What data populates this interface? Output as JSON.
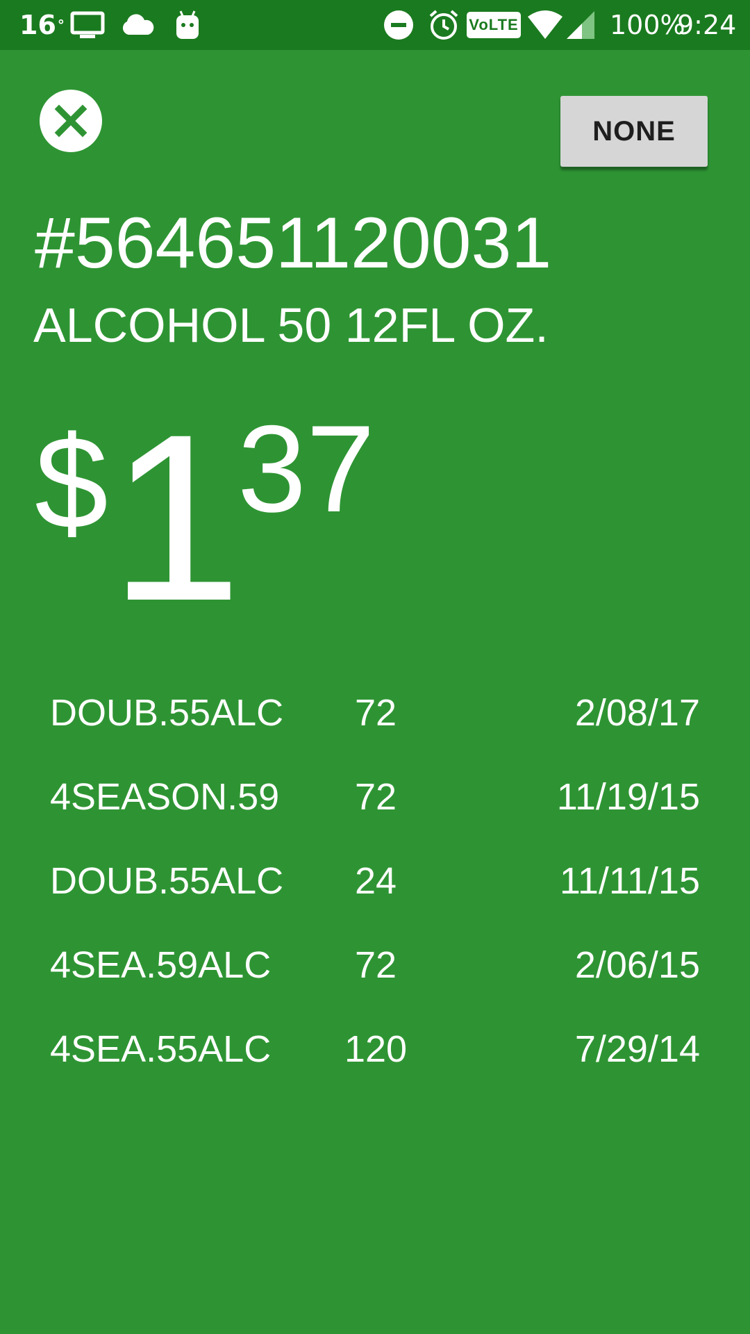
{
  "status_bar": {
    "temperature": "16",
    "temperature_unit": "°",
    "volte_label": "VoLTE",
    "battery": "100%",
    "time": "9:24",
    "icons": [
      "monitor-icon",
      "cloud-icon",
      "android-icon",
      "do-not-disturb-icon",
      "alarm-icon",
      "volte-icon",
      "wifi-icon",
      "cell-signal-icon"
    ]
  },
  "header": {
    "close_icon": "close-icon",
    "none_label": "NONE"
  },
  "product": {
    "number": "#564651120031",
    "description": "ALCOHOL 50 12FL OZ."
  },
  "price": {
    "currency": "$",
    "dollars": "1",
    "cents": "37"
  },
  "history": [
    {
      "name": "DOUB.55ALC",
      "qty": "72",
      "date": "2/08/17"
    },
    {
      "name": "4SEASON.59",
      "qty": "72",
      "date": "11/19/15"
    },
    {
      "name": "DOUB.55ALC",
      "qty": "24",
      "date": "11/11/15"
    },
    {
      "name": "4SEA.59ALC",
      "qty": "72",
      "date": "2/06/15"
    },
    {
      "name": "4SEA.55ALC",
      "qty": "120",
      "date": "7/29/14"
    }
  ],
  "colors": {
    "background": "#2e9433",
    "status_bar": "#1a7a1f",
    "button": "#d6d6d6",
    "text": "#ffffff"
  }
}
